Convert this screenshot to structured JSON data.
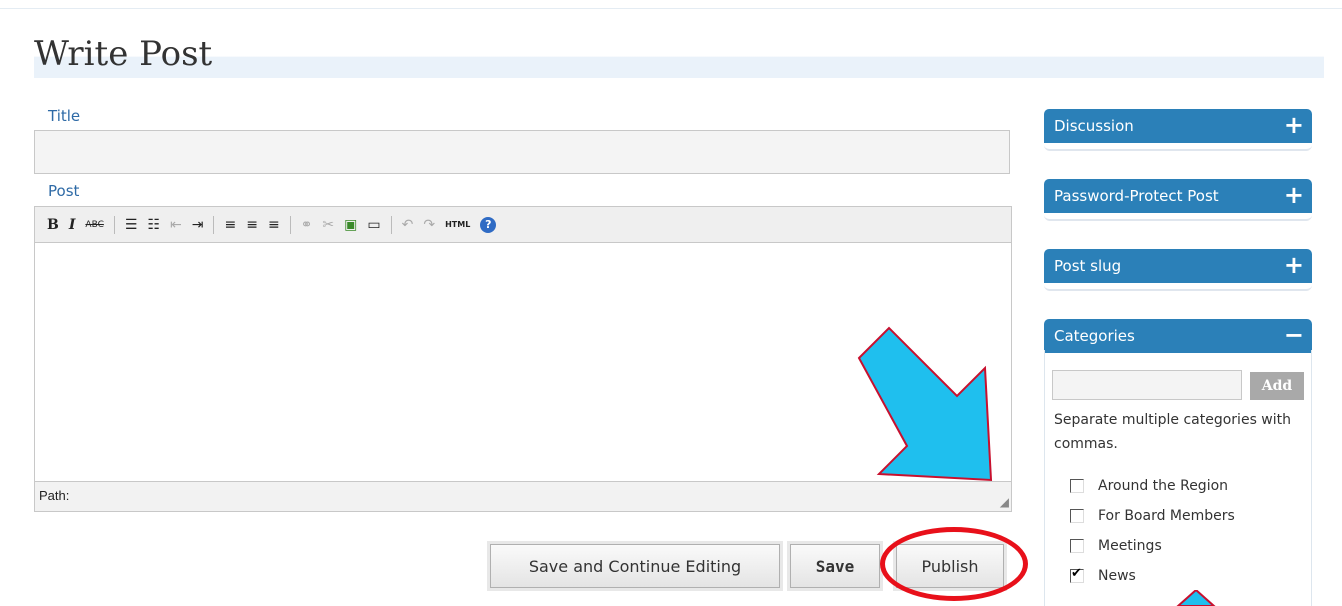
{
  "page": {
    "title": "Write Post"
  },
  "form": {
    "title_label": "Title",
    "title_value": "",
    "post_label": "Post",
    "path_label": "Path:",
    "toolbar_html_label": "HTML"
  },
  "actions": {
    "save_continue": "Save and Continue Editing",
    "save": "Save",
    "publish": "Publish"
  },
  "sidebar": {
    "discussion": {
      "title": "Discussion",
      "toggle": "+"
    },
    "password": {
      "title": "Password-Protect Post",
      "toggle": "+"
    },
    "slug": {
      "title": "Post slug",
      "toggle": "+"
    },
    "categories": {
      "title": "Categories",
      "toggle": "−",
      "add_label": "Add",
      "input_value": "",
      "hint": "Separate multiple categories with commas.",
      "items": [
        {
          "label": "Around the Region",
          "checked": false
        },
        {
          "label": "For Board Members",
          "checked": false
        },
        {
          "label": "Meetings",
          "checked": false
        },
        {
          "label": "News",
          "checked": true
        }
      ]
    }
  },
  "annotations": {
    "arrow_color": "#1fbfee",
    "circle_color": "#e8101a"
  }
}
